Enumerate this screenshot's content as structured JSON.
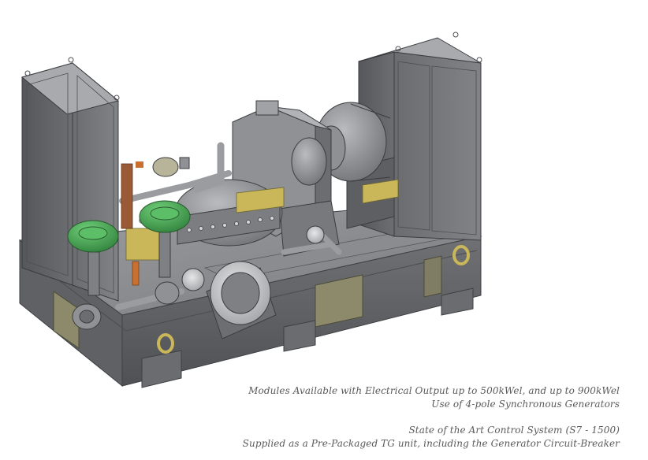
{
  "image": {
    "subject": "turbine-generator-module-isometric-render",
    "colors": {
      "frame": "#7d7f82",
      "frame_dark": "#4e5053",
      "frame_light": "#a3a5a8",
      "valve_green": "#3f9e4d",
      "accent_yellow": "#c9b75a",
      "accent_orange": "#c8702f",
      "accent_brown": "#9a5a35",
      "panel_olive": "#8c8a6b"
    }
  },
  "captions": {
    "line1": "Modules Available with Electrical Output up to 500kWel, and up to 900kWel",
    "line2": "Use of 4-pole Synchronous Generators",
    "line3": "State of the Art Control System (S7 - 1500)",
    "line4": "Supplied as a Pre-Packaged TG unit, including the Generator Circuit-Breaker"
  }
}
